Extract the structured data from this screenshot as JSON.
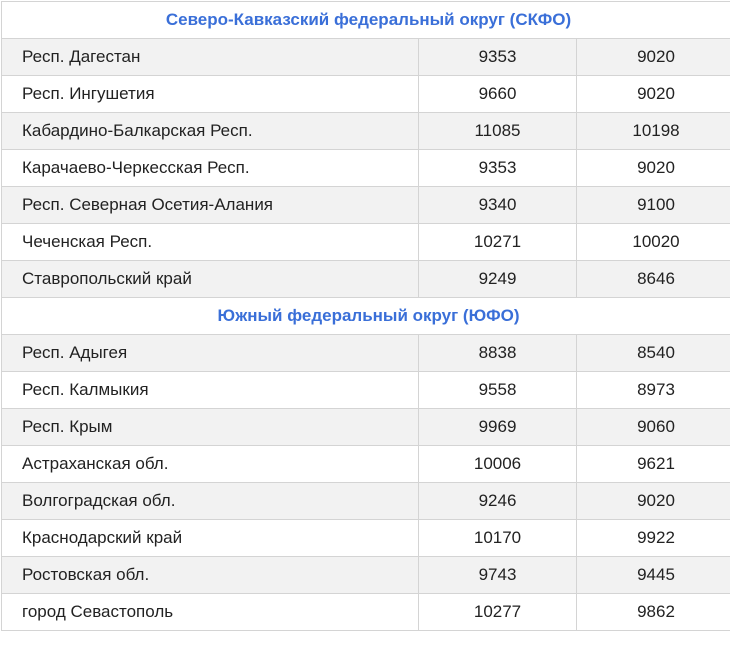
{
  "groups": [
    {
      "title": "Северо-Кавказский федеральный округ (СКФО)",
      "rows": [
        {
          "name": "Респ. Дагестан",
          "v1": "9353",
          "v2": "9020"
        },
        {
          "name": "Респ. Ингушетия",
          "v1": "9660",
          "v2": "9020"
        },
        {
          "name": "Кабардино-Балкарская Респ.",
          "v1": "11085",
          "v2": "10198"
        },
        {
          "name": "Карачаево-Черкесская Респ.",
          "v1": "9353",
          "v2": "9020"
        },
        {
          "name": "Респ. Северная Осетия-Алания",
          "v1": "9340",
          "v2": "9100"
        },
        {
          "name": "Чеченская Респ.",
          "v1": "10271",
          "v2": "10020"
        },
        {
          "name": "Ставропольский край",
          "v1": "9249",
          "v2": "8646"
        }
      ]
    },
    {
      "title": "Южный федеральный округ (ЮФО)",
      "rows": [
        {
          "name": "Респ. Адыгея",
          "v1": "8838",
          "v2": "8540"
        },
        {
          "name": "Респ. Калмыкия",
          "v1": "9558",
          "v2": "8973"
        },
        {
          "name": "Респ. Крым",
          "v1": "9969",
          "v2": "9060"
        },
        {
          "name": "Астраханская обл.",
          "v1": "10006",
          "v2": "9621"
        },
        {
          "name": "Волгоградская обл.",
          "v1": "9246",
          "v2": "9020"
        },
        {
          "name": "Краснодарский край",
          "v1": "10170",
          "v2": "9922"
        },
        {
          "name": "Ростовская обл.",
          "v1": "9743",
          "v2": "9445"
        },
        {
          "name": "город Севастополь",
          "v1": "10277",
          "v2": "9862"
        }
      ]
    }
  ],
  "colors": {
    "group_title": "#3a6fd8",
    "border": "#d4d4d4",
    "row_shaded": "#f2f2f2",
    "row_plain": "#ffffff"
  }
}
